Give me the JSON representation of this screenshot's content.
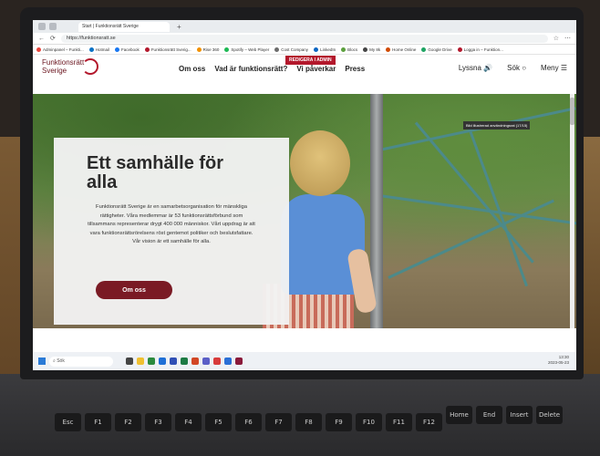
{
  "browser": {
    "tab_title": "Start | Funktionsrätt Sverige",
    "url": "https://funktionsratt.se",
    "bookmarks": [
      "Adminpanel – Funkti...",
      "Hotmail",
      "Facebook",
      "Funktionsrätt Sverig...",
      "Rise 360",
      "Spotify – Web Player",
      "Cost Company",
      "LinkedIn",
      "Blocs",
      "My 8k",
      "Home Online",
      "Google Drive",
      "Logga in – Funktion..."
    ]
  },
  "site": {
    "logo_line1": "Funktionsrätt",
    "logo_line2": "Sverige",
    "nav": [
      "Om oss",
      "Vad är funktionsrätt?",
      "Vi påverkar",
      "Press"
    ],
    "admin_badge": "REDIGERA I ADMIN",
    "listen": "Lyssna",
    "search": "Sök",
    "menu": "Meny"
  },
  "hero": {
    "title": "Ett samhälle för alla",
    "body": "Funktionsrätt Sverige är en samarbetsorganisation för mänskliga rättigheter. Våra medlemmar är 53 funktionsrättsförbund som tillsammans representerar drygt 400 000 människor. Vårt uppdrag är att vara funktionsrättsrörelsens röst gentemot politiker och beslutsfattare. Vår vision är ett samhälle för alla.",
    "button": "Om oss",
    "tooltip": "Bild illustrerad användningsrat (17/15)"
  },
  "taskbar": {
    "search": "Sök",
    "time": "13:30",
    "date": "2023-05-23"
  },
  "keyboard": [
    "Esc",
    "F1",
    "F2",
    "F3",
    "F4",
    "F5",
    "F6",
    "F7",
    "F8",
    "F9",
    "F10",
    "F11",
    "F12",
    "Home",
    "End",
    "Insert",
    "Delete"
  ],
  "colors": {
    "brand": "#7a1a24",
    "accent": "#b3182c"
  }
}
